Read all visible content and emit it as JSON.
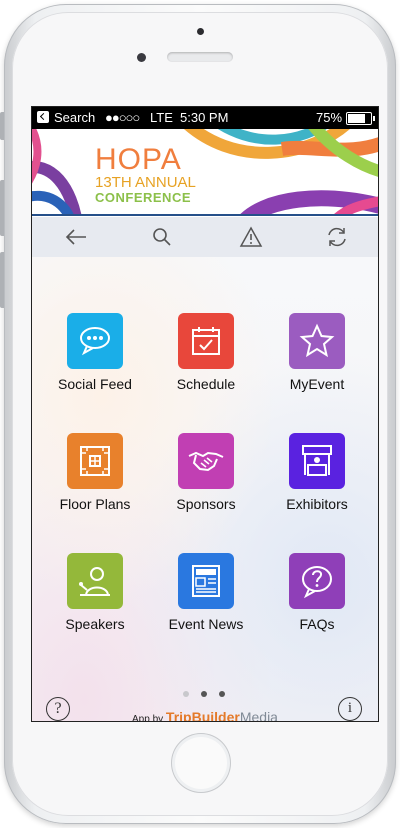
{
  "status_bar": {
    "back_app": "Search",
    "network": "LTE",
    "time": "5:30 PM",
    "battery": "75%"
  },
  "banner": {
    "line1": "HOPA",
    "line2": "13TH ANNUAL",
    "line3": "CONFERENCE"
  },
  "toolbar": {
    "icons": [
      "arrow-back-icon",
      "search-icon",
      "alert-icon",
      "refresh-icon"
    ]
  },
  "grid": [
    {
      "label": "Social Feed",
      "color": "#1aaee8",
      "icon": "chat-bubble-icon"
    },
    {
      "label": "Schedule",
      "color": "#e8473b",
      "icon": "calendar-icon"
    },
    {
      "label": "MyEvent",
      "color": "#9b5cc0",
      "icon": "star-icon"
    },
    {
      "label": "Floor Plans",
      "color": "#e8812c",
      "icon": "floor-plan-icon"
    },
    {
      "label": "Sponsors",
      "color": "#c13fb3",
      "icon": "handshake-icon"
    },
    {
      "label": "Exhibitors",
      "color": "#5a22e0",
      "icon": "booth-icon"
    },
    {
      "label": "Speakers",
      "color": "#94b83a",
      "icon": "speaker-icon"
    },
    {
      "label": "Event News",
      "color": "#2a78e0",
      "icon": "newspaper-icon"
    },
    {
      "label": "FAQs",
      "color": "#8f3fb8",
      "icon": "question-bubble-icon"
    }
  ],
  "pager": {
    "pages": 3,
    "active": 2
  },
  "footer": {
    "help_glyph": "?",
    "info_glyph": "i",
    "credit_prefix": "App by",
    "credit_brand_a": "TripBuilder",
    "credit_brand_b": "Media"
  },
  "colors": {
    "banner_rule": "#26508a",
    "toolbar_bg": "#e7eaf0"
  }
}
